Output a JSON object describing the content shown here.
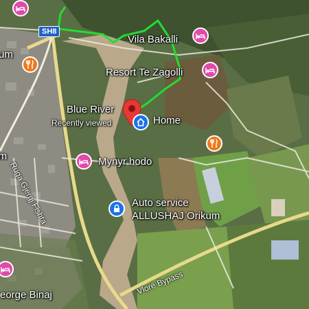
{
  "map": {
    "route_color": "#22dd33",
    "highway_shield": "SH8",
    "roads": {
      "street_1": "Ruga Gjergj Fishta",
      "bypass": "Vlorë Bypass"
    },
    "places": [
      {
        "name": "Vila Bakalli",
        "type": "hotel",
        "icon": "bed-icon",
        "color": "#e04aa8"
      },
      {
        "name": "Resort Te Zagolli",
        "type": "hotel",
        "icon": "bed-icon",
        "color": "#e04aa8"
      },
      {
        "name": "Home",
        "type": "saved-home",
        "icon": "home-icon",
        "color": "#1a73e8"
      },
      {
        "name": "Mynyr hodo",
        "type": "hotel",
        "icon": "bed-icon",
        "color": "#e04aa8"
      },
      {
        "name": "Auto service ALLUSHAJ Orikum",
        "line1": "Auto service",
        "line2": "ALLUSHAJ Orikum",
        "type": "car-service",
        "icon": "lock-icon",
        "color": "#1a73e8"
      },
      {
        "name": "George Binaj",
        "display": "eorge Binaj",
        "type": "hotel",
        "icon": "bed-icon",
        "color": "#e04aa8"
      }
    ],
    "destination": {
      "name": "Blue River",
      "subtitle": "Recently viewed",
      "icon": "location-pin-icon",
      "color": "#e53935"
    },
    "partial_labels": [
      "um",
      "ium"
    ],
    "restaurant_icon": "fork-knife-icon",
    "restaurant_color": "#f07a1a"
  }
}
